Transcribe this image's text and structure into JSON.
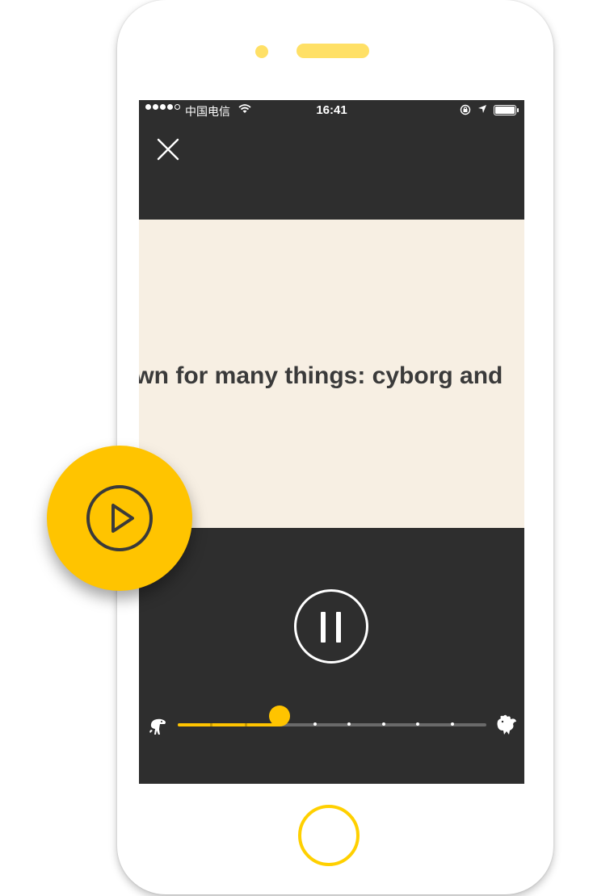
{
  "status_bar": {
    "carrier": "中国电信",
    "time": "16:41"
  },
  "reader": {
    "text": "known for many things: cyborg and"
  },
  "player": {
    "state": "playing",
    "speed_level": 0.33,
    "speed_steps": 9
  },
  "colors": {
    "accent": "#ffc400",
    "screen_background": "#2e2e2e",
    "reading_background": "#f7efe3",
    "text": "#3a3a3a"
  },
  "icons": {
    "close": "close-icon",
    "pause": "pause-icon",
    "play": "play-icon",
    "slow": "dinosaur-icon",
    "fast": "bird-icon"
  }
}
